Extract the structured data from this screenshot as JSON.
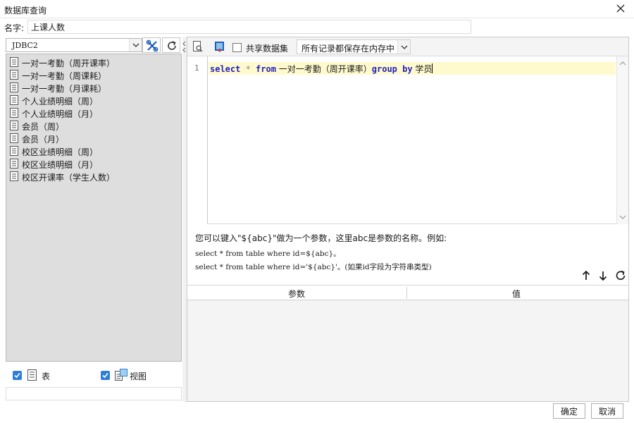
{
  "window": {
    "title": "数据库查询"
  },
  "name_field": {
    "label": "名字:",
    "value": "上课人数"
  },
  "connection": {
    "selected": "JDBC2"
  },
  "tree_items": [
    "一对一考勤（周开课率）",
    "一对一考勤（周课耗）",
    "一对一考勤（月课耗）",
    "个人业绩明细（周）",
    "个人业绩明细（月）",
    "会员（周）",
    "会员（月）",
    "校区业绩明细（周）",
    "校区业绩明细（月）",
    "校区开课率（学生人数）"
  ],
  "filters": {
    "table_label": "表",
    "view_label": "视图"
  },
  "toolbar": {
    "share_label": "共享数据集",
    "mode_value": "所有记录都保存在内存中"
  },
  "editor": {
    "line_number": "1",
    "tokens": {
      "select": "select",
      "star": " * ",
      "from": "from",
      "table": " 一对一考勤（周开课率）",
      "group": "group",
      "by": "by",
      "column": " 学员"
    }
  },
  "hint": {
    "line1": "您可以键入\"${abc}\"做为一个参数，这里abc是参数的名称。例如:",
    "line2": "select * from table where id=${abc}。",
    "line3": "select * from table where id='${abc}'。(如果id字段为字符串类型)"
  },
  "param_table": {
    "col_param": "参数",
    "col_value": "值"
  },
  "footer": {
    "ok_label": "确定",
    "cancel_label": "取消"
  },
  "colors": {
    "accent": "#2f7fd8",
    "keyword": "#1f1fbf",
    "current_line": "#fffacd",
    "tree_bg": "#dedede"
  }
}
